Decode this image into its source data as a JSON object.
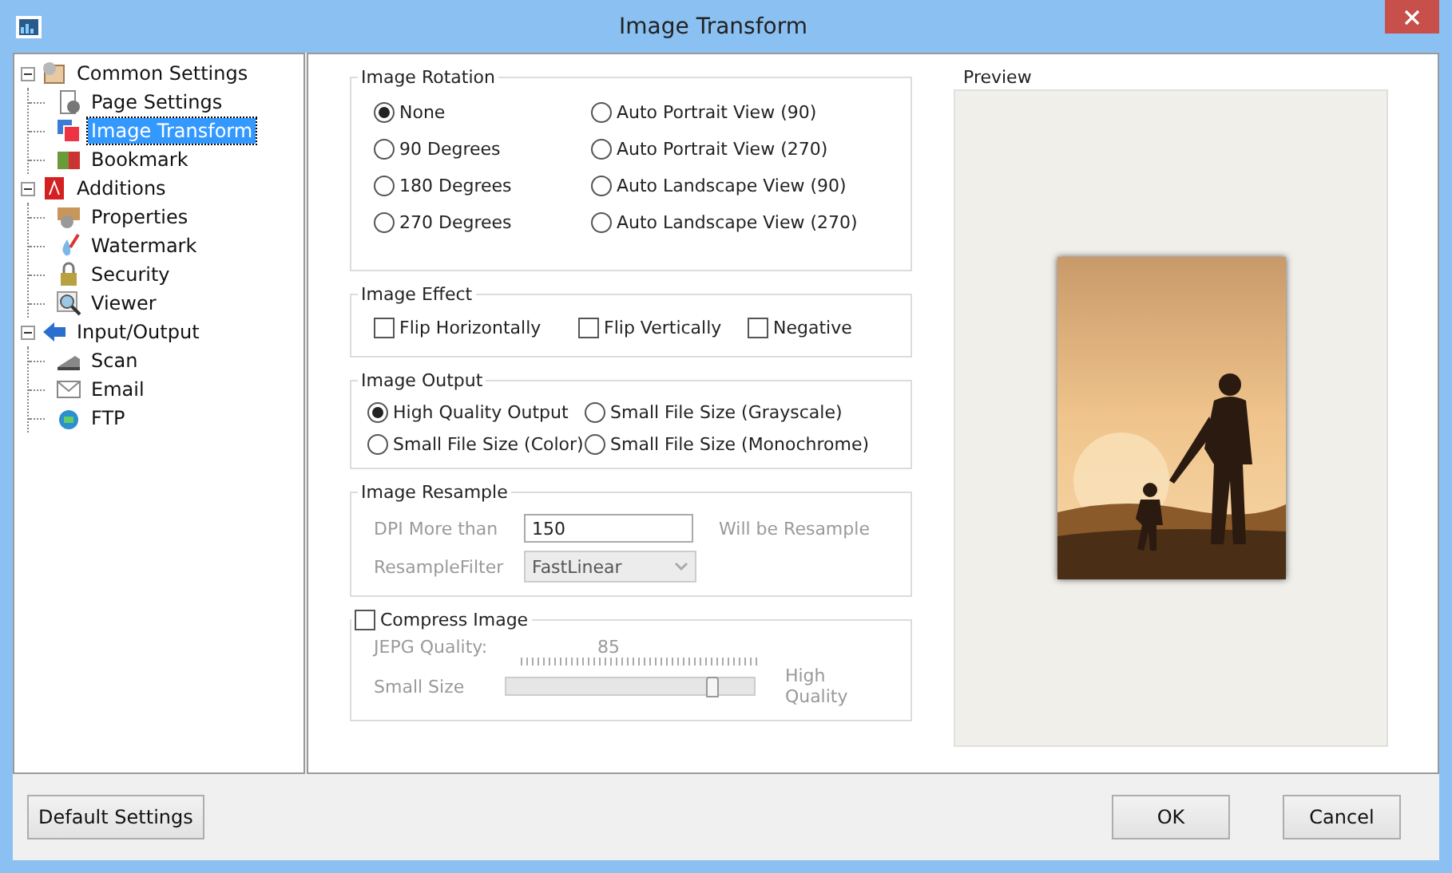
{
  "window": {
    "title": "Image Transform"
  },
  "tree": [
    {
      "label": "Common Settings",
      "expanded": true,
      "selected": false,
      "children": [
        {
          "label": "Page Settings",
          "selected": false
        },
        {
          "label": "Image Transform",
          "selected": true
        },
        {
          "label": "Bookmark",
          "selected": false
        }
      ]
    },
    {
      "label": "Additions",
      "expanded": true,
      "selected": false,
      "children": [
        {
          "label": "Properties",
          "selected": false
        },
        {
          "label": "Watermark",
          "selected": false
        },
        {
          "label": "Security",
          "selected": false
        },
        {
          "label": "Viewer",
          "selected": false
        }
      ]
    },
    {
      "label": "Input/Output",
      "expanded": true,
      "selected": false,
      "children": [
        {
          "label": "Scan",
          "selected": false
        },
        {
          "label": "Email",
          "selected": false
        },
        {
          "label": "FTP",
          "selected": false
        }
      ]
    }
  ],
  "rotation": {
    "title": "Image Rotation",
    "options": [
      {
        "label": "None",
        "selected": true
      },
      {
        "label": "Auto Portrait View (90)",
        "selected": false
      },
      {
        "label": "90 Degrees",
        "selected": false
      },
      {
        "label": "Auto Portrait View (270)",
        "selected": false
      },
      {
        "label": "180 Degrees",
        "selected": false
      },
      {
        "label": "Auto Landscape View (90)",
        "selected": false
      },
      {
        "label": "270 Degrees",
        "selected": false
      },
      {
        "label": "Auto Landscape View (270)",
        "selected": false
      }
    ]
  },
  "effect": {
    "title": "Image Effect",
    "options": [
      {
        "label": "Flip Horizontally",
        "checked": false
      },
      {
        "label": "Flip Vertically",
        "checked": false
      },
      {
        "label": "Negative",
        "checked": false
      }
    ]
  },
  "output": {
    "title": "Image Output",
    "options": [
      {
        "label": "High Quality Output",
        "selected": true
      },
      {
        "label": "Small File Size (Grayscale)",
        "selected": false
      },
      {
        "label": "Small File Size (Color)",
        "selected": false
      },
      {
        "label": "Small File Size (Monochrome)",
        "selected": false
      }
    ]
  },
  "resample": {
    "title": "Image Resample",
    "disabled": true,
    "dpi_label": "DPI More than",
    "dpi_value": "150",
    "dpi_note": "Will be Resample",
    "filter_label": "ResampleFilter",
    "filter_value": "FastLinear"
  },
  "compress": {
    "title": "Compress Image",
    "checked": false,
    "disabled": true,
    "quality_label": "JEPG Quality:",
    "quality_value": "85",
    "min_label": "Small Size",
    "max_label": "High Quality",
    "level": 0.83
  },
  "preview": {
    "title": "Preview"
  },
  "buttons": {
    "default": "Default Settings",
    "ok": "OK",
    "cancel": "Cancel"
  }
}
